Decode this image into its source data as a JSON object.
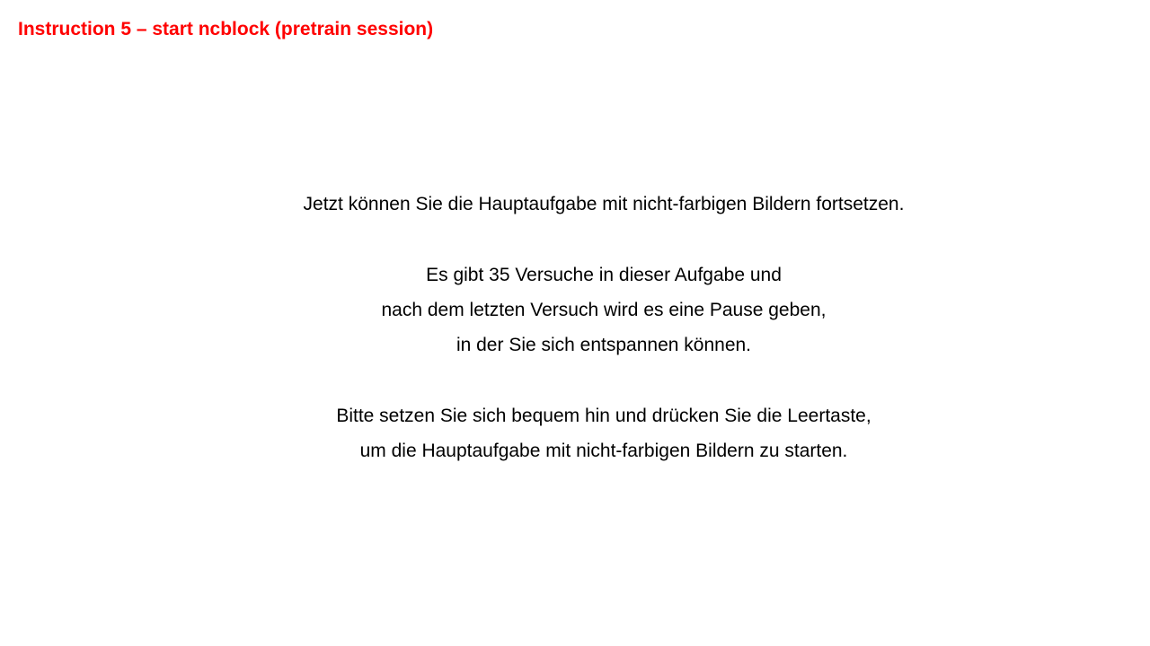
{
  "slide": {
    "title": "Instruction 5 – start ncblock (pretrain session)",
    "title_color": "#ff0000",
    "paragraphs": [
      {
        "lines": [
          "Jetzt können Sie die Hauptaufgabe mit nicht-farbigen Bildern fortsetzen."
        ]
      },
      {
        "lines": [
          "Es gibt 35 Versuche in dieser Aufgabe und",
          "nach dem letzten Versuch wird es eine Pause geben,",
          "in der Sie sich entspannen können."
        ]
      },
      {
        "lines": [
          "Bitte setzen Sie sich bequem hin und drücken Sie die Leertaste,",
          "um die Hauptaufgabe mit nicht-farbigen Bildern zu starten."
        ]
      }
    ]
  }
}
